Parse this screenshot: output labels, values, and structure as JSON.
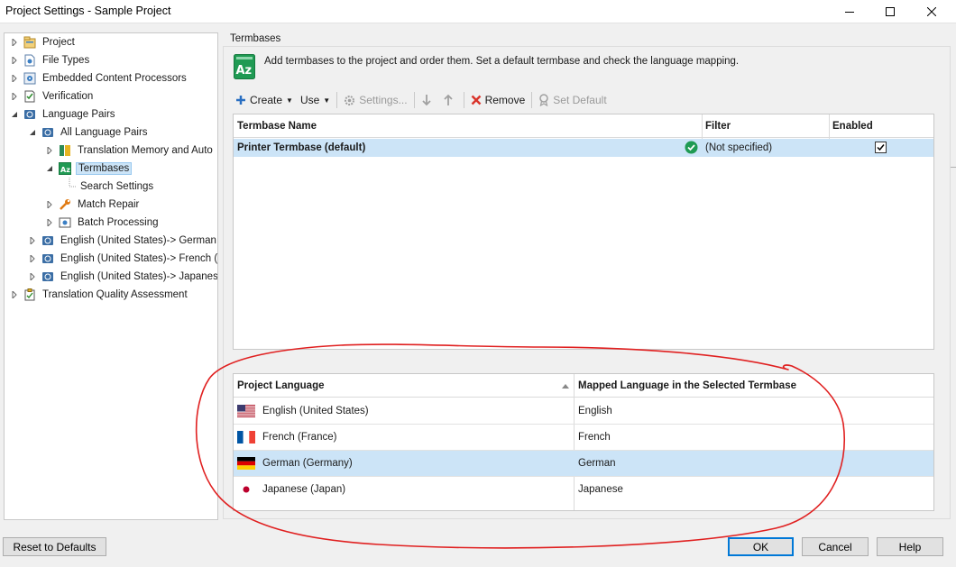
{
  "window": {
    "title": "Project Settings - Sample Project"
  },
  "tree": {
    "items": [
      {
        "label": "Project"
      },
      {
        "label": "File Types"
      },
      {
        "label": "Embedded Content Processors"
      },
      {
        "label": "Verification"
      },
      {
        "label": "Language Pairs"
      },
      {
        "label": "All Language Pairs"
      },
      {
        "label": "Translation Memory and Auto"
      },
      {
        "label": "Termbases"
      },
      {
        "label": "Search Settings"
      },
      {
        "label": "Match Repair"
      },
      {
        "label": "Batch Processing"
      },
      {
        "label": "English (United States)-> German ("
      },
      {
        "label": "English (United States)-> French (F"
      },
      {
        "label": "English (United States)-> Japanese"
      },
      {
        "label": "Translation Quality Assessment"
      }
    ]
  },
  "panel": {
    "title": "Termbases",
    "info": "Add termbases to the project and order them. Set a default termbase and check the language mapping."
  },
  "toolbar": {
    "create": "Create",
    "use": "Use",
    "settings": "Settings...",
    "remove": "Remove",
    "set_default": "Set Default"
  },
  "termbase_table": {
    "headers": [
      "Termbase Name",
      "Filter",
      "Enabled"
    ],
    "rows": [
      {
        "name": "Printer Termbase (default)",
        "filter": "(Not specified)",
        "enabled": true
      }
    ]
  },
  "language_table": {
    "headers": [
      "Project Language",
      "Mapped Language in the Selected Termbase"
    ],
    "rows": [
      {
        "language": "English (United States)",
        "mapped": "English",
        "flag": "us-flag-icon"
      },
      {
        "language": "French (France)",
        "mapped": "French",
        "flag": "fr-flag-icon"
      },
      {
        "language": "German (Germany)",
        "mapped": "German",
        "flag": "de-flag-icon"
      },
      {
        "language": "Japanese (Japan)",
        "mapped": "Japanese",
        "flag": "jp-flag-icon"
      }
    ],
    "selected_row": 2
  },
  "buttons": {
    "reset": "Reset to Defaults",
    "ok": "OK",
    "cancel": "Cancel",
    "help": "Help"
  },
  "colors": {
    "selection": "#cce4f7",
    "annotation": "#e02020",
    "accent": "#0078d7"
  }
}
